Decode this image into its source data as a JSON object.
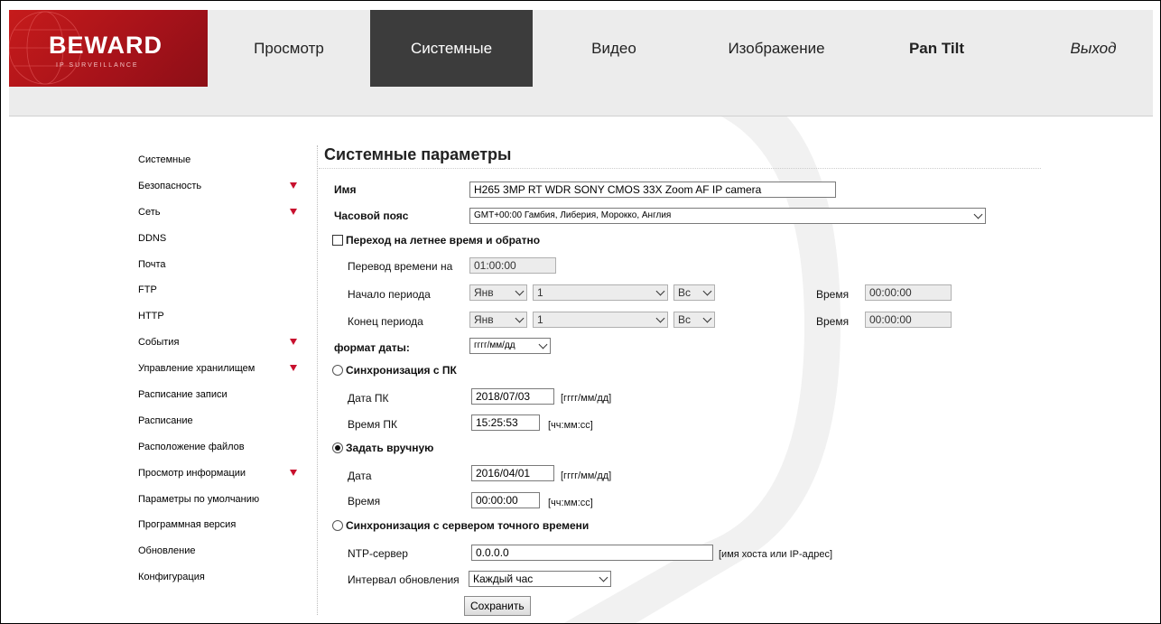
{
  "logo": {
    "brand": "BEWARD",
    "subtitle": "IP SURVEILLANCE"
  },
  "colors": {
    "brand_red": "#c61b1b",
    "active_tab": "#3c3c3c",
    "header_bg": "#ececec",
    "arrow": "#c8102e"
  },
  "nav": {
    "tabs": [
      {
        "label": "Просмотр"
      },
      {
        "label": "Системные"
      },
      {
        "label": "Видео"
      },
      {
        "label": "Изображение"
      },
      {
        "label": "Pan Tilt"
      },
      {
        "label": "Выход"
      }
    ],
    "active": "Системные"
  },
  "sidebar": {
    "items": [
      {
        "label": "Системные",
        "has_submenu": false
      },
      {
        "label": "Безопасность",
        "has_submenu": true
      },
      {
        "label": "Сеть",
        "has_submenu": true
      },
      {
        "label": "DDNS",
        "has_submenu": false
      },
      {
        "label": "Почта",
        "has_submenu": false
      },
      {
        "label": "FTP",
        "has_submenu": false
      },
      {
        "label": "HTTP",
        "has_submenu": false
      },
      {
        "label": "События",
        "has_submenu": true
      },
      {
        "label": "Управление хранилищем",
        "has_submenu": true
      },
      {
        "label": "Расписание записи",
        "has_submenu": false
      },
      {
        "label": "Расписание",
        "has_submenu": false
      },
      {
        "label": "Расположение файлов",
        "has_submenu": false
      },
      {
        "label": "Просмотр информации",
        "has_submenu": true
      },
      {
        "label": "Параметры по умолчанию",
        "has_submenu": false
      },
      {
        "label": "Программная версия",
        "has_submenu": false
      },
      {
        "label": "Обновление",
        "has_submenu": false
      },
      {
        "label": "Конфигурация",
        "has_submenu": false
      }
    ]
  },
  "form": {
    "title": "Системные параметры",
    "name_label": "Имя",
    "name_value": "H265 3MP RT WDR SONY CMOS 33X Zoom AF IP camera",
    "timezone_label": "Часовой пояс",
    "timezone_value": "GMT+00:00 Гамбия, Либерия, Морокко, Англия",
    "dst": {
      "label": "Переход на летнее время и обратно",
      "checked": false,
      "shift_label": "Перевод времени на",
      "shift_value": "01:00:00",
      "start_label": "Начало периода",
      "start_month": "Янв",
      "start_week": "1",
      "start_day": "Вс",
      "start_time_label": "Время",
      "start_time": "00:00:00",
      "end_label": "Конец периода",
      "end_month": "Янв",
      "end_week": "1",
      "end_day": "Вс",
      "end_time_label": "Время",
      "end_time": "00:00:00"
    },
    "date_format_label": "формат даты:",
    "date_format_value": "гггг/мм/дд",
    "sync_pc": {
      "label": "Синхронизация с ПК",
      "selected": false,
      "date_label": "Дата ПК",
      "date_value": "2018/07/03",
      "date_hint": "[гггг/мм/дд]",
      "time_label": "Время ПК",
      "time_value": "15:25:53",
      "time_hint": "[чч:мм:сс]"
    },
    "manual": {
      "label": "Задать вручную",
      "selected": true,
      "date_label": "Дата",
      "date_value": "2016/04/01",
      "date_hint": "[гггг/мм/дд]",
      "time_label": "Время",
      "time_value": "00:00:00",
      "time_hint": "[чч:мм:сс]"
    },
    "ntp": {
      "label": "Синхронизация с сервером точного времени",
      "selected": false,
      "server_label": "NTP-сервер",
      "server_value": "0.0.0.0",
      "server_hint": "[имя хоста или IP-адрес]",
      "interval_label": "Интервал обновления",
      "interval_value": "Каждый час"
    },
    "save_label": "Сохранить"
  }
}
